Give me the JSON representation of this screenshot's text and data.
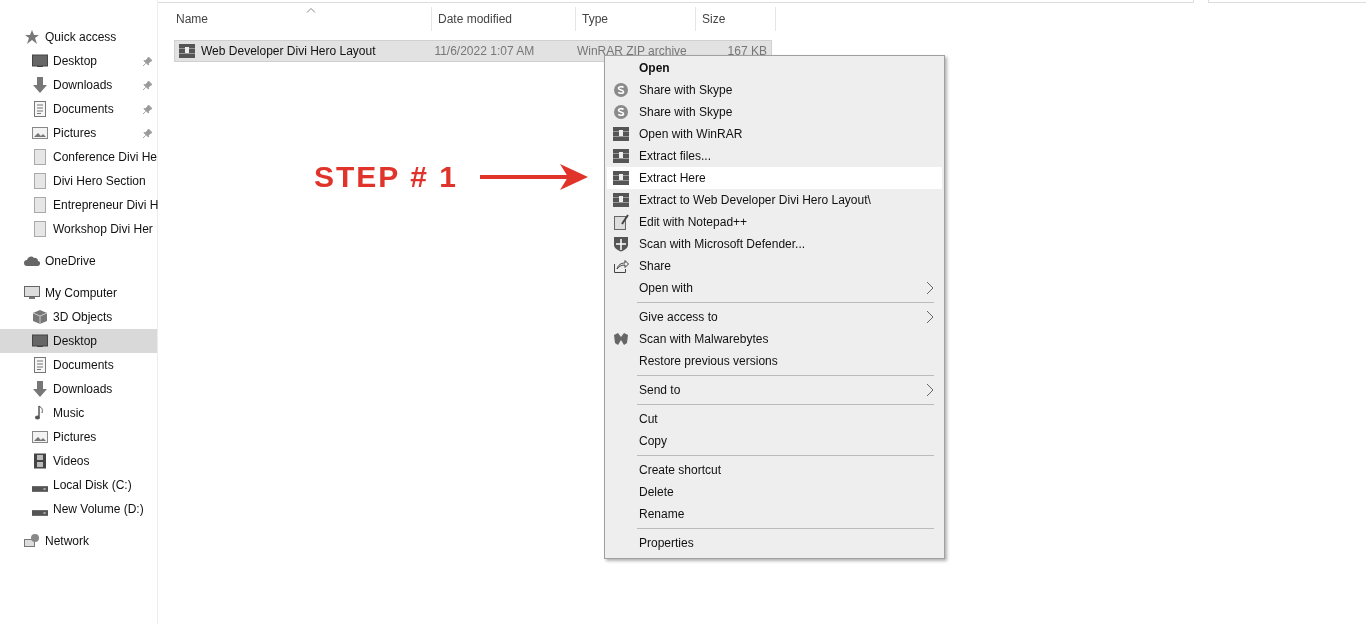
{
  "sidebar": {
    "sections": [
      {
        "label": "Quick access",
        "kind": "star",
        "selected": false,
        "children": [
          {
            "label": "Desktop",
            "kind": "desktop",
            "pinned": true,
            "selected": false
          },
          {
            "label": "Downloads",
            "kind": "download",
            "pinned": true,
            "selected": false
          },
          {
            "label": "Documents",
            "kind": "document",
            "pinned": true,
            "selected": false
          },
          {
            "label": "Pictures",
            "kind": "pictures",
            "pinned": true,
            "selected": false
          },
          {
            "label": "Conference Divi He",
            "kind": "file",
            "pinned": false,
            "selected": false
          },
          {
            "label": "Divi Hero Section",
            "kind": "file",
            "pinned": false,
            "selected": false
          },
          {
            "label": "Entrepreneur Divi H",
            "kind": "file",
            "pinned": false,
            "selected": false
          },
          {
            "label": "Workshop Divi Her",
            "kind": "file",
            "pinned": false,
            "selected": false
          }
        ]
      },
      {
        "label": "OneDrive",
        "kind": "cloud",
        "selected": false
      },
      {
        "label": "My Computer",
        "kind": "computer",
        "selected": false,
        "children": [
          {
            "label": "3D Objects",
            "kind": "cube",
            "pinned": false,
            "selected": false
          },
          {
            "label": "Desktop",
            "kind": "desktop",
            "pinned": false,
            "selected": true
          },
          {
            "label": "Documents",
            "kind": "document",
            "pinned": false,
            "selected": false
          },
          {
            "label": "Downloads",
            "kind": "download",
            "pinned": false,
            "selected": false
          },
          {
            "label": "Music",
            "kind": "music",
            "pinned": false,
            "selected": false
          },
          {
            "label": "Pictures",
            "kind": "pictures",
            "pinned": false,
            "selected": false
          },
          {
            "label": "Videos",
            "kind": "film",
            "pinned": false,
            "selected": false
          },
          {
            "label": "Local Disk (C:)",
            "kind": "drive",
            "pinned": false,
            "selected": false
          },
          {
            "label": "New Volume (D:)",
            "kind": "drive",
            "pinned": false,
            "selected": false
          }
        ]
      },
      {
        "label": "Network",
        "kind": "network",
        "selected": false
      }
    ]
  },
  "table": {
    "columns": [
      "Name",
      "Date modified",
      "Type",
      "Size"
    ],
    "rows": [
      {
        "name": "Web Developer Divi Hero Layout",
        "date_modified": "11/6/2022 1:07 AM",
        "type": "WinRAR ZIP archive",
        "size": "167 KB",
        "selected": true
      }
    ]
  },
  "context_menu": {
    "items": [
      {
        "kind": "plain",
        "label": "Open",
        "default": true,
        "highlighted": false,
        "submenu": false
      },
      {
        "kind": "skype",
        "label": "Share with Skype",
        "default": false,
        "highlighted": false,
        "submenu": false
      },
      {
        "kind": "skype",
        "label": "Share with Skype",
        "default": false,
        "highlighted": false,
        "submenu": false
      },
      {
        "kind": "archive",
        "label": "Open with WinRAR",
        "default": false,
        "highlighted": false,
        "submenu": false
      },
      {
        "kind": "archive",
        "label": "Extract files...",
        "default": false,
        "highlighted": false,
        "submenu": false
      },
      {
        "kind": "archive",
        "label": "Extract Here",
        "default": false,
        "highlighted": true,
        "submenu": false
      },
      {
        "kind": "archive",
        "label": "Extract to Web Developer Divi Hero Layout\\",
        "default": false,
        "highlighted": false,
        "submenu": false
      },
      {
        "kind": "notepad",
        "label": "Edit with Notepad++",
        "default": false,
        "highlighted": false,
        "submenu": false
      },
      {
        "kind": "shield",
        "label": "Scan with Microsoft Defender...",
        "default": false,
        "highlighted": false,
        "submenu": false
      },
      {
        "kind": "share",
        "label": "Share",
        "default": false,
        "highlighted": false,
        "submenu": false
      },
      {
        "kind": "plain",
        "label": "Open with",
        "default": false,
        "highlighted": false,
        "submenu": true
      },
      {
        "kind": "separator"
      },
      {
        "kind": "plain",
        "label": "Give access to",
        "default": false,
        "highlighted": false,
        "submenu": true
      },
      {
        "kind": "malwarebytes",
        "label": "Scan with Malwarebytes",
        "default": false,
        "highlighted": false,
        "submenu": false
      },
      {
        "kind": "plain",
        "label": "Restore previous versions",
        "default": false,
        "highlighted": false,
        "submenu": false
      },
      {
        "kind": "separator"
      },
      {
        "kind": "plain",
        "label": "Send to",
        "default": false,
        "highlighted": false,
        "submenu": true
      },
      {
        "kind": "separator"
      },
      {
        "kind": "plain",
        "label": "Cut",
        "default": false,
        "highlighted": false,
        "submenu": false
      },
      {
        "kind": "plain",
        "label": "Copy",
        "default": false,
        "highlighted": false,
        "submenu": false
      },
      {
        "kind": "separator"
      },
      {
        "kind": "plain",
        "label": "Create shortcut",
        "default": false,
        "highlighted": false,
        "submenu": false
      },
      {
        "kind": "plain",
        "label": "Delete",
        "default": false,
        "highlighted": false,
        "submenu": false
      },
      {
        "kind": "plain",
        "label": "Rename",
        "default": false,
        "highlighted": false,
        "submenu": false
      },
      {
        "kind": "separator"
      },
      {
        "kind": "plain",
        "label": "Properties",
        "default": false,
        "highlighted": false,
        "submenu": false
      }
    ]
  },
  "annotation": {
    "label": "STEP # 1",
    "color": "#e0332a"
  }
}
